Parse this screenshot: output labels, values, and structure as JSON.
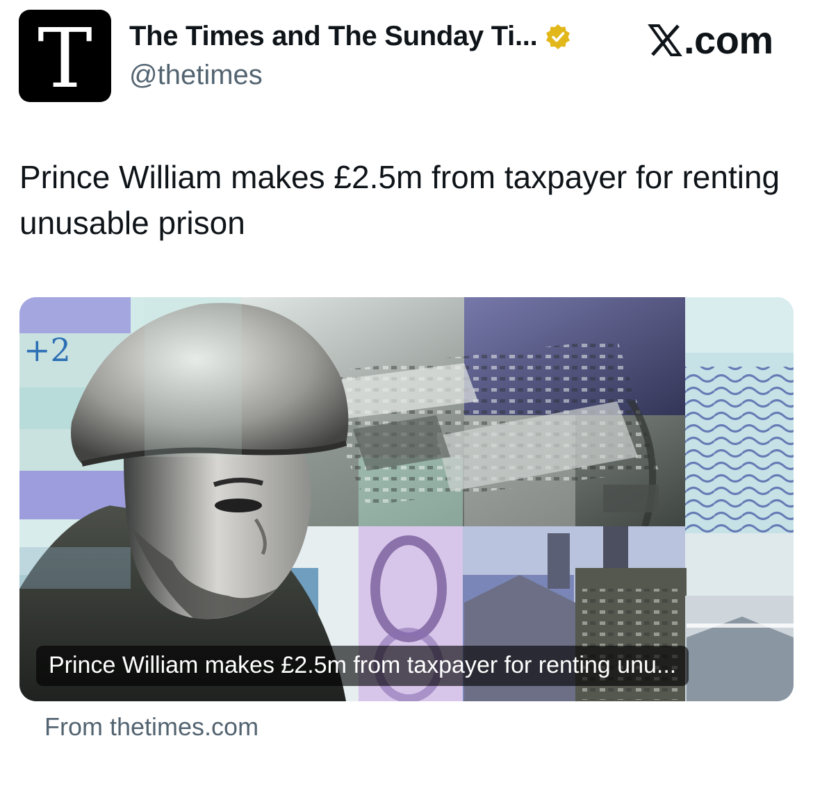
{
  "account": {
    "avatar_letter": "T",
    "display_name": "The Times and The Sunday Ti...",
    "handle": "@thetimes",
    "verified_icon": "verified-gold-badge"
  },
  "platform": {
    "logo_icon": "x-logo",
    "domain_label": ".com"
  },
  "tweet": {
    "text": "Prince William makes £2.5m from taxpayer for renting unusable prison"
  },
  "link_card": {
    "image": "collage-man-in-flat-cap-prison-banknote",
    "caption": "Prince William makes £2.5m from taxpayer for renting unu...",
    "source": "From thetimes.com"
  },
  "colors": {
    "text_primary": "#0f1419",
    "text_secondary": "#536471",
    "verified_gold": "#e2b719",
    "card_mint": "#c9e2e0",
    "card_lavender": "#9d9ddd"
  }
}
